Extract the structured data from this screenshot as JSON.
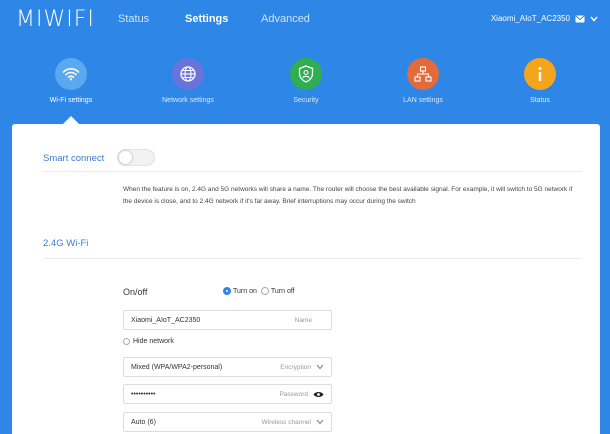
{
  "header": {
    "logo": "MIWIFI",
    "nav": [
      {
        "label": "Status",
        "active": false
      },
      {
        "label": "Settings",
        "active": true
      },
      {
        "label": "Advanced",
        "active": false
      }
    ],
    "router_name": "Xiaomi_AIoT_AC2350"
  },
  "functions": [
    {
      "label": "Wi-Fi settings",
      "icon": "wifi-icon",
      "color": "#5aa9f0",
      "active": true
    },
    {
      "label": "Network settings",
      "icon": "globe-icon",
      "color": "#6a73dc",
      "active": false
    },
    {
      "label": "Security",
      "icon": "shield-icon",
      "color": "#2fae52",
      "active": false
    },
    {
      "label": "LAN settings",
      "icon": "network-tree-icon",
      "color": "#e36a3b",
      "active": false
    },
    {
      "label": "Status",
      "icon": "info-icon",
      "color": "#f4a51c",
      "active": false
    }
  ],
  "smart_connect": {
    "label": "Smart connect",
    "enabled": false,
    "description": "When the feature is on, 2.4G and 5G networks will share a name. The router will choose the best available signal. For example, it will switch to 5G network if the device is close, and to 2.4G network if it's far away. Brief interruptions may occur during the switch"
  },
  "wifi24": {
    "section_title": "2.4G Wi-Fi",
    "onoff_label": "On/off",
    "turn_on": "Turn on",
    "turn_off": "Turn off",
    "selected": "on",
    "name_value": "Xiaomi_AIoT_AC2350",
    "name_hint": "Name",
    "hide_network": "Hide network",
    "encryption_value": "Mixed (WPA/WPA2-personal)",
    "encryption_hint": "Encryption",
    "password_value": "••••••••••",
    "password_hint": "Password",
    "channel_value": "Auto (6)",
    "channel_hint": "Wireless channel"
  },
  "colors": {
    "background": "#2e87e6",
    "accent": "#3a7cd1"
  }
}
